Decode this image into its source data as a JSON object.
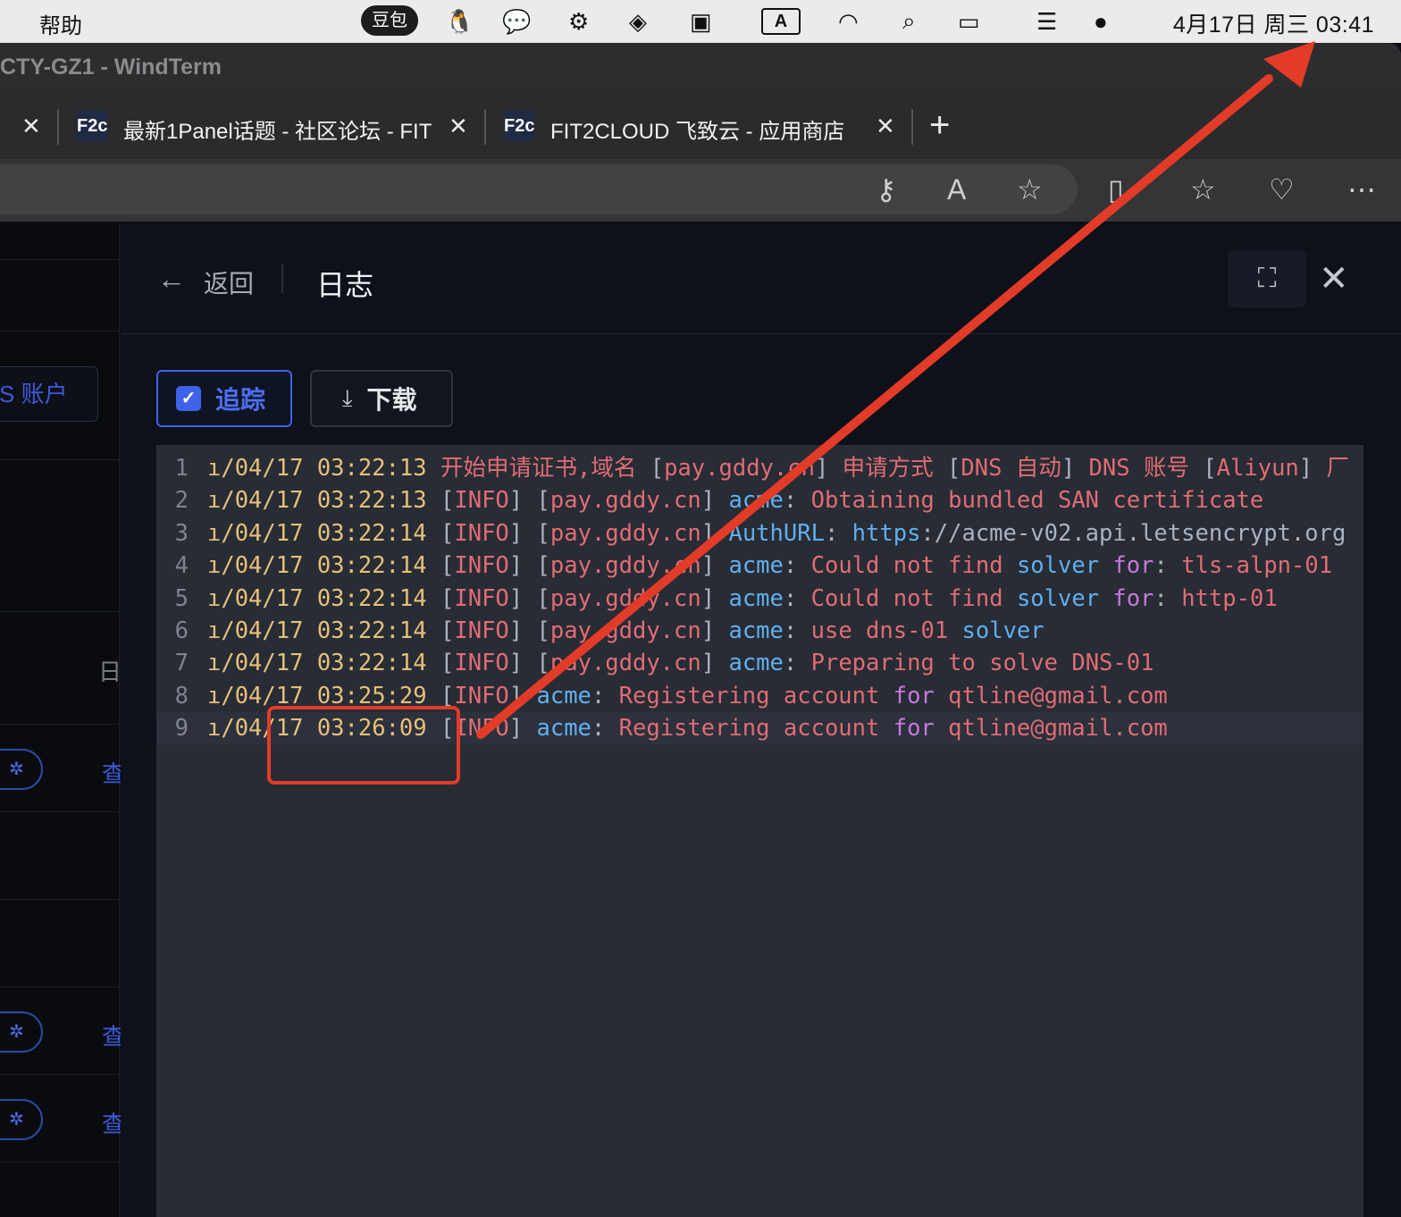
{
  "menubar": {
    "help": "帮助",
    "doubao": "豆包",
    "input_method": "A",
    "clock": "4月17日 周三  03:41"
  },
  "window": {
    "title": "CTY-GZ1 - WindTerm"
  },
  "tabs": [
    {
      "title": "最新1Panel话题 - 社区论坛 - FIT",
      "favicon": "F2c"
    },
    {
      "title": "FIT2CLOUD 飞致云 - 应用商店",
      "favicon": "F2c"
    }
  ],
  "sidebar": {
    "account_button": "S 账户",
    "header_fragment": "日",
    "row_action": "查"
  },
  "drawer": {
    "back_label": "返回",
    "title": "日志"
  },
  "actions": {
    "trace_label": "追踪",
    "trace_checked": true,
    "download_label": "下载"
  },
  "log": {
    "lines": [
      {
        "n": "1",
        "date": "ı/04/17",
        "time": "03:22:13",
        "text": "开始申请证书,域名 [pay.gddy.cn] 申请方式 [DNS 自动] DNS 账号 [Aliyun] 厂"
      },
      {
        "n": "2",
        "date": "ı/04/17",
        "time": "03:22:13",
        "text": "[INFO] [pay.gddy.cn] acme: Obtaining bundled SAN certificate"
      },
      {
        "n": "3",
        "date": "ı/04/17",
        "time": "03:22:14",
        "text": "[INFO] [pay.gddy.cn] AuthURL: https://acme-v02.api.letsencrypt.org"
      },
      {
        "n": "4",
        "date": "ı/04/17",
        "time": "03:22:14",
        "text": "[INFO] [pay.gddy.cn] acme: Could not find solver for: tls-alpn-01"
      },
      {
        "n": "5",
        "date": "ı/04/17",
        "time": "03:22:14",
        "text": "[INFO] [pay.gddy.cn] acme: Could not find solver for: http-01"
      },
      {
        "n": "6",
        "date": "ı/04/17",
        "time": "03:22:14",
        "text": "[INFO] [pay.gddy.cn] acme: use dns-01 solver"
      },
      {
        "n": "7",
        "date": "ı/04/17",
        "time": "03:22:14",
        "text": "[INFO] [pay.gddy.cn] acme: Preparing to solve DNS-01"
      },
      {
        "n": "8",
        "date": "ı/04/17",
        "time": "03:25:29",
        "text": "[INFO] acme: Registering account for qtline@gmail.com"
      },
      {
        "n": "9",
        "date": "ı/04/17",
        "time": "03:26:09",
        "text": "[INFO] acme: Registering account for qtline@gmail.com"
      }
    ]
  },
  "colors": {
    "accent": "#3f63e8",
    "annotation": "#e23b28",
    "log_bg": "#282c34"
  }
}
